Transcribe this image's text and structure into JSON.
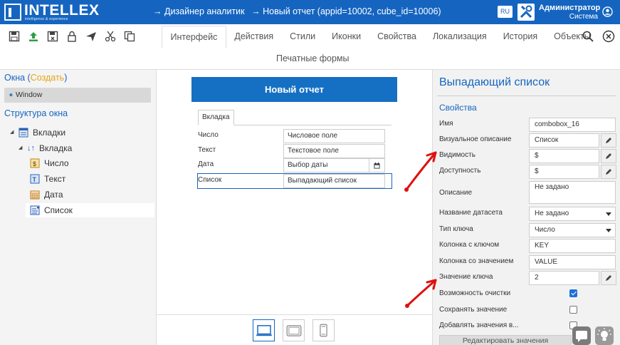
{
  "header": {
    "logo_text": "INTELLEX",
    "logo_tagline": "intelligence & experience",
    "breadcrumb": [
      "→ Дизайнер аналитик",
      "→ Новый отчет (appid=10002, cube_id=10006)"
    ],
    "language": "RU",
    "user_name": "Администратор",
    "user_role": "Система",
    "brand_color": "#1565c0"
  },
  "toolbar": {
    "icons": [
      "save-icon",
      "upload-icon",
      "save-as-icon",
      "lock-icon",
      "send-icon",
      "cut-icon",
      "copy-icon"
    ],
    "tabs": [
      "Интерфейс",
      "Действия",
      "Стили",
      "Иконки",
      "Свойства",
      "Локализация",
      "История",
      "Объекты"
    ],
    "active_tab": "Интерфейс",
    "tab_row2": "Печатные формы"
  },
  "left_panel": {
    "windows_title": "Окна",
    "create_link": "Создать",
    "window_item": "Window",
    "structure_title": "Структура окна",
    "tree": [
      {
        "label": "Вкладки",
        "icon": "tabs-icon"
      },
      {
        "label": "Вкладка",
        "icon": "sort-arrows-icon"
      },
      {
        "label": "Число",
        "icon": "number-icon"
      },
      {
        "label": "Текст",
        "icon": "text-icon"
      },
      {
        "label": "Дата",
        "icon": "calendar-icon"
      },
      {
        "label": "Список",
        "icon": "list-icon"
      }
    ]
  },
  "canvas": {
    "form_title": "Новый отчет",
    "tab_label": "Вкладка",
    "rows": [
      {
        "label": "Число",
        "value": "Числовое поле"
      },
      {
        "label": "Текст",
        "value": "Текстовое поле"
      },
      {
        "label": "Дата",
        "value": "Выбор даты"
      },
      {
        "label": "Список",
        "value": "Выпадающий список"
      }
    ],
    "devices": [
      "desktop-icon",
      "tablet-icon",
      "phone-icon"
    ]
  },
  "right_panel": {
    "title": "Выпадающий список",
    "section": "Свойства",
    "props": [
      {
        "label": "Имя",
        "value": "combobox_16"
      },
      {
        "label": "Визуальное описание",
        "value": "Список"
      },
      {
        "label": "Видимость",
        "value": "$"
      },
      {
        "label": "Доступность",
        "value": "$"
      },
      {
        "label": "Описание",
        "value": "Не задано"
      },
      {
        "label": "Название датасета",
        "value": "Не задано"
      },
      {
        "label": "Тип ключа",
        "value": "Число"
      },
      {
        "label": "Колонка с ключом",
        "value": "KEY"
      },
      {
        "label": "Колонка со значением",
        "value": "VALUE"
      },
      {
        "label": "Значение ключа",
        "value": "2"
      }
    ],
    "checkboxes": [
      {
        "label": "Возможность очистки",
        "checked": true
      },
      {
        "label": "Сохранять значение",
        "checked": false
      },
      {
        "label": "Добавлять значения в...",
        "checked": false
      }
    ],
    "edit_values_button": "Редактировать значения"
  },
  "colors": {
    "annotation_arrows": "#e01010",
    "checkbox_on": "#1e6fd9"
  }
}
